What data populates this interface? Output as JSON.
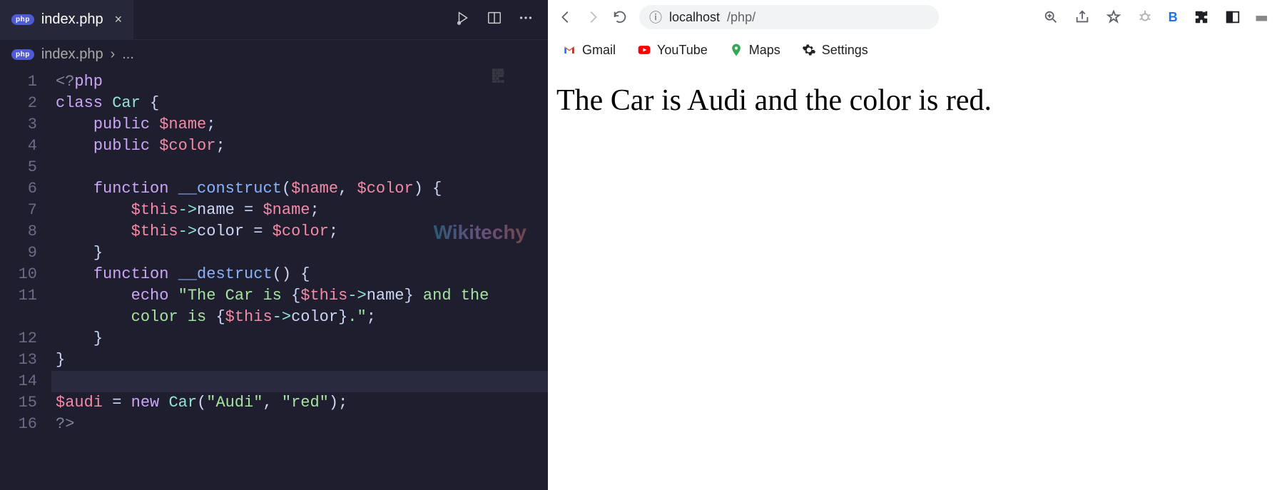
{
  "editor": {
    "tab": {
      "badge": "php",
      "title": "index.php",
      "close_glyph": "×",
      "actions_present": [
        "debug-run",
        "split",
        "more"
      ]
    },
    "breadcrumb": {
      "badge": "php",
      "file": "index.php",
      "sep": "›",
      "tail": "..."
    },
    "watermark": "Wikitechy",
    "line_numbers": [
      "1",
      "2",
      "3",
      "4",
      "5",
      "6",
      "7",
      "8",
      "9",
      "10",
      "11",
      "",
      "12",
      "13",
      "14",
      "15",
      "16"
    ],
    "code": {
      "l1": {
        "open": "<?",
        "php": "php"
      },
      "l2": {
        "kw": "class",
        "sp": " ",
        "cls": "Car",
        "sp2": " ",
        "brace": "{"
      },
      "l3": {
        "pad": "    ",
        "kw": "public",
        "sp": " ",
        "var": "$name",
        "semi": ";"
      },
      "l4": {
        "pad": "    ",
        "kw": "public",
        "sp": " ",
        "var": "$color",
        "semi": ";"
      },
      "l5": {
        "pad": ""
      },
      "l6": {
        "pad": "    ",
        "kw": "function",
        "sp": " ",
        "fn": "__construct",
        "open": "(",
        "p1": "$name",
        "c": ", ",
        "p2": "$color",
        "close": ") ",
        "brace": "{"
      },
      "l7": {
        "pad": "        ",
        "this": "$this",
        "arrow": "->",
        "prop": "name",
        "sp": " = ",
        "var": "$name",
        "semi": ";"
      },
      "l8": {
        "pad": "        ",
        "this": "$this",
        "arrow": "->",
        "prop": "color",
        "sp": " = ",
        "var": "$color",
        "semi": ";"
      },
      "l9": {
        "pad": "    ",
        "brace": "}"
      },
      "l10": {
        "pad": "    ",
        "kw": "function",
        "sp": " ",
        "fn": "__destruct",
        "open": "()",
        "sp2": " ",
        "brace": "{"
      },
      "l11": {
        "pad": "        ",
        "kw": "echo",
        "sp": " ",
        "s1": "\"The Car is ",
        "ob": "{",
        "this": "$this",
        "arrow": "->",
        "prop": "name",
        "cb": "}",
        "s2": " and the "
      },
      "l11b": {
        "pad": "        ",
        "s1": "color is ",
        "ob": "{",
        "this": "$this",
        "arrow": "->",
        "prop": "color",
        "cb": "}",
        "s2": ".\"",
        "semi": ";"
      },
      "l12": {
        "pad": "    ",
        "brace": "}"
      },
      "l13": {
        "brace": "}"
      },
      "l14": {
        "pad": ""
      },
      "l15": {
        "var": "$audi",
        "sp": " = ",
        "kw": "new",
        "sp2": " ",
        "cls": "Car",
        "open": "(",
        "s1": "\"Audi\"",
        "c": ", ",
        "s2": "\"red\"",
        "close": ")",
        "semi": ";"
      },
      "l16": {
        "close": "?>"
      }
    }
  },
  "browser": {
    "url": {
      "info_glyph": "ⓘ",
      "host": "localhost",
      "path": "/php/"
    },
    "bookmarks": [
      {
        "name": "Gmail",
        "color": "#ea4335"
      },
      {
        "name": "YouTube",
        "color": "#ff0000"
      },
      {
        "name": "Maps",
        "color": "#1a73e8"
      },
      {
        "name": "Settings",
        "color": "#000"
      }
    ],
    "page_output": "The Car is Audi and the color is red.",
    "toolbar_icons": [
      "zoom",
      "share",
      "star",
      "bug",
      "b-ext",
      "puzzle",
      "panel",
      "brand"
    ]
  }
}
